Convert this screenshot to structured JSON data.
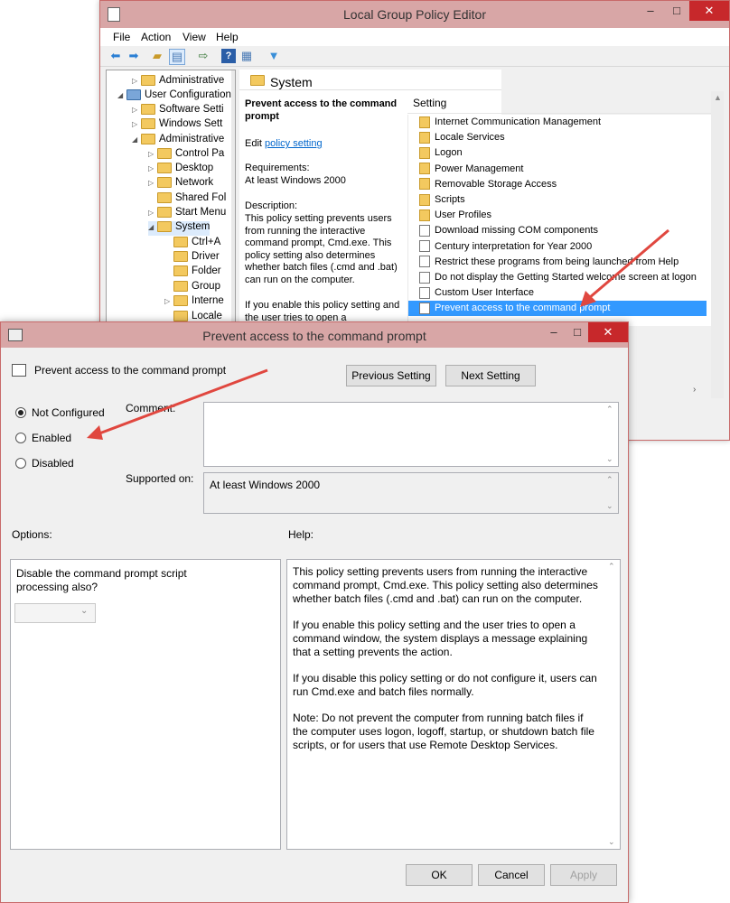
{
  "gpe": {
    "title": "Local Group Policy Editor",
    "caption": {
      "minimize": "–",
      "maximize": "□",
      "close": "✕"
    },
    "menu": [
      "File",
      "Action",
      "View",
      "Help"
    ],
    "toolbar_icons": [
      "back-icon",
      "forward-icon",
      "up-folder-icon",
      "show-hide-tree-icon",
      "export-list-icon",
      "help-icon",
      "properties-icon",
      "filter-icon"
    ],
    "tree": [
      {
        "label": "Administrative",
        "expander": "▷"
      },
      {
        "label": "User Configuration",
        "expander": "◢"
      },
      {
        "label": "Software Setti",
        "expander": "▷"
      },
      {
        "label": "Windows Sett",
        "expander": "▷"
      },
      {
        "label": "Administrative",
        "expander": "◢"
      },
      {
        "label": "Control Pa",
        "expander": "▷"
      },
      {
        "label": "Desktop",
        "expander": "▷"
      },
      {
        "label": "Network",
        "expander": "▷"
      },
      {
        "label": "Shared Fol",
        "expander": ""
      },
      {
        "label": "Start Menu",
        "expander": "▷"
      },
      {
        "label": "System",
        "expander": "◢"
      },
      {
        "label": "Ctrl+A",
        "expander": ""
      },
      {
        "label": "Driver",
        "expander": ""
      },
      {
        "label": "Folder",
        "expander": ""
      },
      {
        "label": "Group",
        "expander": ""
      },
      {
        "label": "Interne",
        "expander": "▷"
      },
      {
        "label": "Locale",
        "expander": ""
      }
    ],
    "header_title": "System",
    "description": {
      "title": "Prevent access to the command prompt",
      "edit_prefix": "Edit ",
      "edit_link": "policy setting",
      "requirements_label": "Requirements:",
      "requirements_value": "At least Windows 2000",
      "description_label": "Description:",
      "description_text": "This policy setting prevents users from running the interactive command prompt, Cmd.exe.  This policy setting also determines whether batch files (.cmd and .bat) can run on the computer.",
      "description_more": "If you enable this policy setting and the user tries to open a"
    },
    "list_header": "Setting",
    "list": [
      {
        "label": "Internet Communication Management",
        "type": "folder"
      },
      {
        "label": "Locale Services",
        "type": "folder"
      },
      {
        "label": "Logon",
        "type": "folder"
      },
      {
        "label": "Power Management",
        "type": "folder"
      },
      {
        "label": "Removable Storage Access",
        "type": "folder"
      },
      {
        "label": "Scripts",
        "type": "folder"
      },
      {
        "label": "User Profiles",
        "type": "folder"
      },
      {
        "label": "Download missing COM components",
        "type": "policy"
      },
      {
        "label": "Century interpretation for Year 2000",
        "type": "policy"
      },
      {
        "label": "Restrict these programs from being launched from Help",
        "type": "policy"
      },
      {
        "label": "Do not display the Getting Started welcome screen at logon",
        "type": "policy"
      },
      {
        "label": "Custom User Interface",
        "type": "policy"
      },
      {
        "label": "Prevent access to the command prompt",
        "type": "policy",
        "selected": true
      }
    ]
  },
  "dialog": {
    "title": "Prevent access to the command prompt",
    "caption": {
      "minimize": "–",
      "maximize": "□",
      "close": "✕"
    },
    "policy_name": "Prevent access to the command prompt",
    "previous_label": "Previous Setting",
    "next_label": "Next Setting",
    "state_options": [
      {
        "label": "Not Configured",
        "checked": true
      },
      {
        "label": "Enabled",
        "checked": false
      },
      {
        "label": "Disabled",
        "checked": false
      }
    ],
    "comment_label": "Comment:",
    "comment_value": "",
    "supported_label": "Supported on:",
    "supported_value": "At least Windows 2000",
    "options_label": "Options:",
    "help_label": "Help:",
    "option_text": "Disable the command prompt script processing also?",
    "option_value": "",
    "help_paragraphs": [
      "This policy setting prevents users from running the interactive command prompt, Cmd.exe.  This policy setting also determines whether batch files (.cmd and .bat) can run on the computer.",
      "If you enable this policy setting and the user tries to open a command window, the system displays a message explaining that a setting prevents the action.",
      "If you disable this policy setting or do not configure it, users can run Cmd.exe and batch files normally.",
      "Note: Do not prevent the computer from running batch files if the computer uses logon, logoff, startup, or shutdown batch file scripts, or for users that use Remote Desktop Services."
    ],
    "ok_label": "OK",
    "cancel_label": "Cancel",
    "apply_label": "Apply"
  },
  "annotation_color": "#e0473f"
}
